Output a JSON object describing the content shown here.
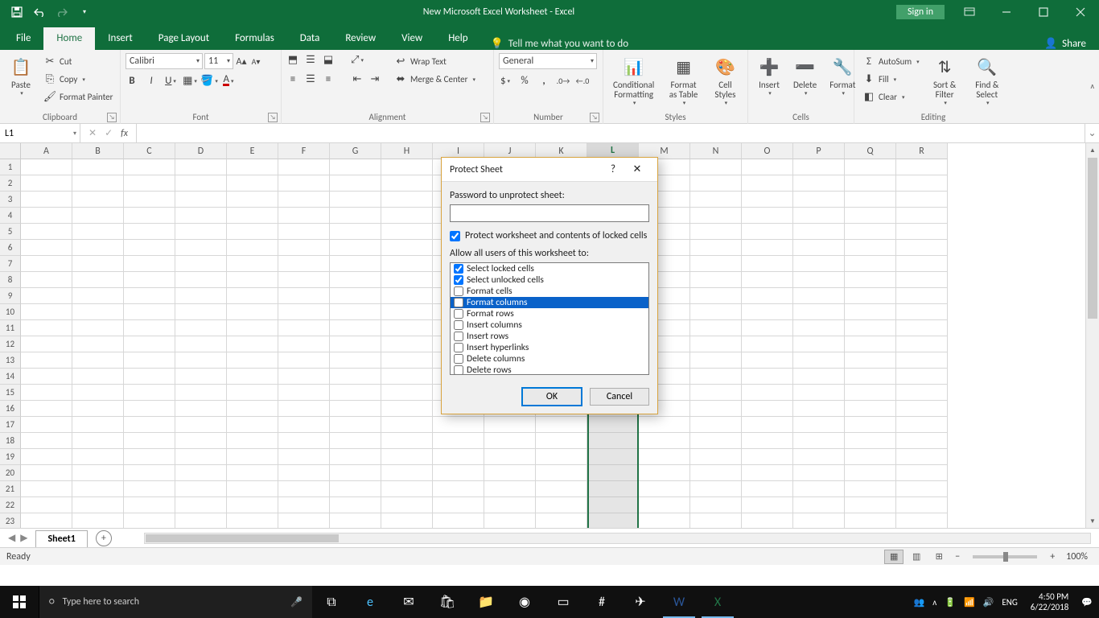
{
  "titlebar": {
    "title": "New Microsoft Excel Worksheet - Excel",
    "signin": "Sign in"
  },
  "tabs": {
    "file": "File",
    "items": [
      "Home",
      "Insert",
      "Page Layout",
      "Formulas",
      "Data",
      "Review",
      "View",
      "Help"
    ],
    "active": "Home",
    "tellme": "Tell me what you want to do",
    "share": "Share"
  },
  "ribbon": {
    "clipboard": {
      "label": "Clipboard",
      "paste": "Paste",
      "cut": "Cut",
      "copy": "Copy",
      "fmtpainter": "Format Painter"
    },
    "font": {
      "label": "Font",
      "name": "Calibri",
      "size": "11"
    },
    "alignment": {
      "label": "Alignment",
      "wrap": "Wrap Text",
      "merge": "Merge & Center"
    },
    "number": {
      "label": "Number",
      "format": "General"
    },
    "styles": {
      "label": "Styles",
      "cond": "Conditional Formatting",
      "table": "Format as Table",
      "cell": "Cell Styles"
    },
    "cells": {
      "label": "Cells",
      "insert": "Insert",
      "delete": "Delete",
      "format": "Format"
    },
    "editing": {
      "label": "Editing",
      "autosum": "AutoSum",
      "fill": "Fill",
      "clear": "Clear",
      "sort": "Sort & Filter",
      "find": "Find & Select"
    }
  },
  "fxbar": {
    "name": "L1",
    "formula": ""
  },
  "grid": {
    "columns": [
      "A",
      "B",
      "C",
      "D",
      "E",
      "F",
      "G",
      "H",
      "I",
      "J",
      "K",
      "L",
      "M",
      "N",
      "O",
      "P",
      "Q",
      "R"
    ],
    "rows": 23,
    "selected_column_index": 11,
    "selected_column": "L",
    "active_cell": "L1"
  },
  "sheet": {
    "active": "Sheet1"
  },
  "statusbar": {
    "mode": "Ready",
    "zoom": "100%"
  },
  "dialog": {
    "title": "Protect Sheet",
    "password_label": "Password to unprotect sheet:",
    "password_value": "",
    "protect_label": "Protect worksheet and contents of locked cells",
    "protect_checked": true,
    "allow_label": "Allow all users of this worksheet to:",
    "options": [
      {
        "label": "Select locked cells",
        "checked": true,
        "selected": false
      },
      {
        "label": "Select unlocked cells",
        "checked": true,
        "selected": false
      },
      {
        "label": "Format cells",
        "checked": false,
        "selected": false
      },
      {
        "label": "Format columns",
        "checked": false,
        "selected": true
      },
      {
        "label": "Format rows",
        "checked": false,
        "selected": false
      },
      {
        "label": "Insert columns",
        "checked": false,
        "selected": false
      },
      {
        "label": "Insert rows",
        "checked": false,
        "selected": false
      },
      {
        "label": "Insert hyperlinks",
        "checked": false,
        "selected": false
      },
      {
        "label": "Delete columns",
        "checked": false,
        "selected": false
      },
      {
        "label": "Delete rows",
        "checked": false,
        "selected": false
      }
    ],
    "ok": "OK",
    "cancel": "Cancel"
  },
  "taskbar": {
    "search_placeholder": "Type here to search",
    "lang": "ENG",
    "time": "4:50 PM",
    "date": "6/22/2018"
  }
}
